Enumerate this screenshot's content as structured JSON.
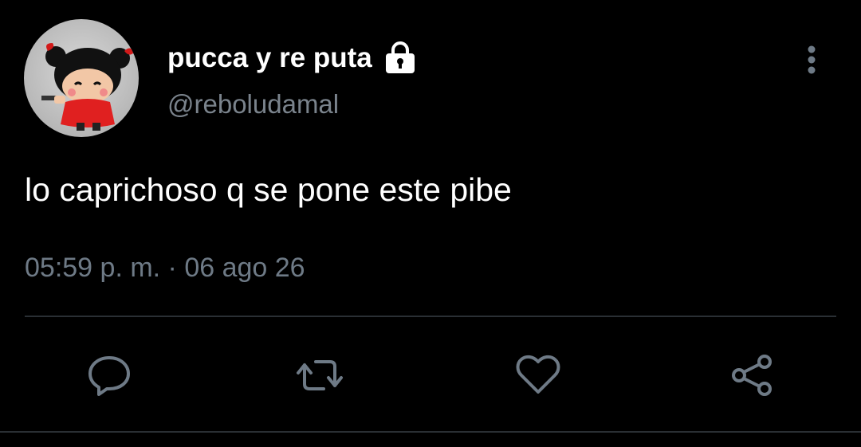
{
  "profile": {
    "display_name": "pucca y re puta",
    "handle": "@reboludamal",
    "avatar_icon": "pucca-avatar",
    "locked_icon": "lock-icon"
  },
  "tweet": {
    "text": "lo caprichoso q se pone este pibe",
    "timestamp": "05:59 p. m. · 06 ago 26"
  },
  "actions": [
    {
      "icon": "reply-icon"
    },
    {
      "icon": "retweet-icon"
    },
    {
      "icon": "like-icon"
    },
    {
      "icon": "share-icon"
    }
  ],
  "colors": {
    "background": "#000000",
    "primary_text": "#ffffff",
    "secondary_text": "#6e7a86",
    "icon": "#6e7a86",
    "divider": "#2a2f34"
  }
}
